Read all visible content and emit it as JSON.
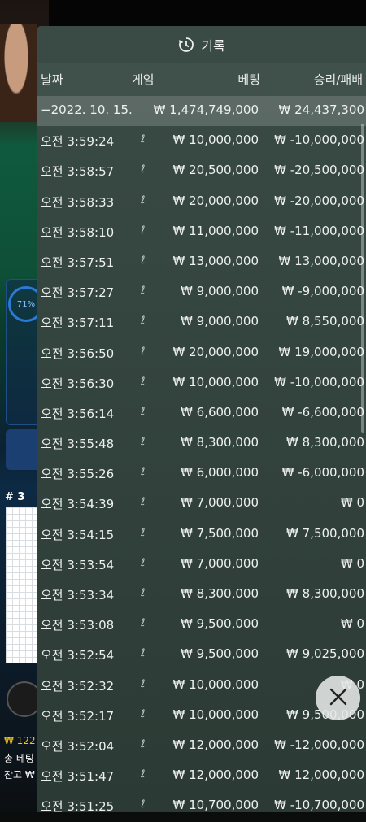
{
  "title": "기록",
  "columns": {
    "date": "날짜",
    "game": "게임",
    "bet": "베팅",
    "win_loss": "승리/패배"
  },
  "summary": {
    "date": "−2022. 10. 15.",
    "bet": "₩ 1,474,749,000",
    "win_loss": "₩ 24,437,300"
  },
  "rows": [
    {
      "time": "오전 3:59:24",
      "game": "ℓ",
      "bet": "₩ 10,000,000",
      "win_loss": "₩ -10,000,000"
    },
    {
      "time": "오전 3:58:57",
      "game": "ℓ",
      "bet": "₩ 20,500,000",
      "win_loss": "₩ -20,500,000"
    },
    {
      "time": "오전 3:58:33",
      "game": "ℓ",
      "bet": "₩ 20,000,000",
      "win_loss": "₩ -20,000,000"
    },
    {
      "time": "오전 3:58:10",
      "game": "ℓ",
      "bet": "₩ 11,000,000",
      "win_loss": "₩ -11,000,000"
    },
    {
      "time": "오전 3:57:51",
      "game": "ℓ",
      "bet": "₩ 13,000,000",
      "win_loss": "₩ 13,000,000"
    },
    {
      "time": "오전 3:57:27",
      "game": "ℓ",
      "bet": "₩ 9,000,000",
      "win_loss": "₩ -9,000,000"
    },
    {
      "time": "오전 3:57:11",
      "game": "ℓ",
      "bet": "₩ 9,000,000",
      "win_loss": "₩ 8,550,000"
    },
    {
      "time": "오전 3:56:50",
      "game": "ℓ",
      "bet": "₩ 20,000,000",
      "win_loss": "₩ 19,000,000"
    },
    {
      "time": "오전 3:56:30",
      "game": "ℓ",
      "bet": "₩ 10,000,000",
      "win_loss": "₩ -10,000,000"
    },
    {
      "time": "오전 3:56:14",
      "game": "ℓ",
      "bet": "₩ 6,600,000",
      "win_loss": "₩ -6,600,000"
    },
    {
      "time": "오전 3:55:48",
      "game": "ℓ",
      "bet": "₩ 8,300,000",
      "win_loss": "₩ 8,300,000"
    },
    {
      "time": "오전 3:55:26",
      "game": "ℓ",
      "bet": "₩ 6,000,000",
      "win_loss": "₩ -6,000,000"
    },
    {
      "time": "오전 3:54:39",
      "game": "ℓ",
      "bet": "₩ 7,000,000",
      "win_loss": "₩ 0"
    },
    {
      "time": "오전 3:54:15",
      "game": "ℓ",
      "bet": "₩ 7,500,000",
      "win_loss": "₩ 7,500,000"
    },
    {
      "time": "오전 3:53:54",
      "game": "ℓ",
      "bet": "₩ 7,000,000",
      "win_loss": "₩ 0"
    },
    {
      "time": "오전 3:53:34",
      "game": "ℓ",
      "bet": "₩ 8,300,000",
      "win_loss": "₩ 8,300,000"
    },
    {
      "time": "오전 3:53:08",
      "game": "ℓ",
      "bet": "₩ 9,500,000",
      "win_loss": "₩ 0"
    },
    {
      "time": "오전 3:52:54",
      "game": "ℓ",
      "bet": "₩ 9,500,000",
      "win_loss": "₩ 9,025,000"
    },
    {
      "time": "오전 3:52:32",
      "game": "ℓ",
      "bet": "₩ 10,000,000",
      "win_loss": "₩ 0"
    },
    {
      "time": "오전 3:52:17",
      "game": "ℓ",
      "bet": "₩ 10,000,000",
      "win_loss": "₩ 9,500,000"
    },
    {
      "time": "오전 3:52:04",
      "game": "ℓ",
      "bet": "₩ 12,000,000",
      "win_loss": "₩ -12,000,000"
    },
    {
      "time": "오전 3:51:47",
      "game": "ℓ",
      "bet": "₩ 12,000,000",
      "win_loss": "₩ 12,000,000"
    },
    {
      "time": "오전 3:51:25",
      "game": "ℓ",
      "bet": "₩ 10,700,000",
      "win_loss": "₩ -10,700,000"
    }
  ],
  "background": {
    "progress_label": "71%",
    "progress_value": 0.71,
    "road_label": "# 3",
    "balance_prefix": "₩ 122",
    "total_bet_prefix": "총 베팅",
    "balance_label": "잔고 ₩"
  },
  "icons": {
    "history": "clock-history-icon",
    "close": "close-icon"
  }
}
